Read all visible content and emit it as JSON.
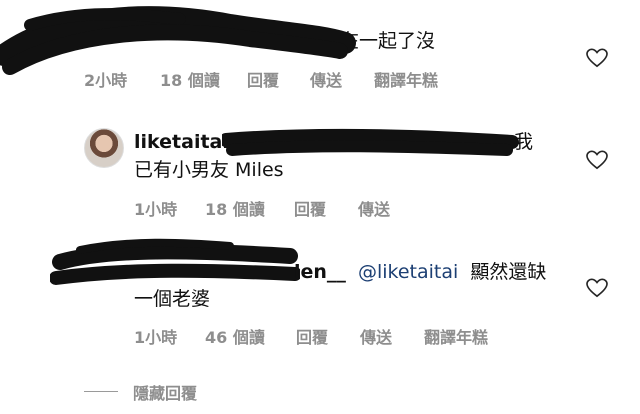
{
  "colors": {
    "meta": "#8e8e8e",
    "mention": "#1c3f73",
    "text": "#111111"
  },
  "comments": [
    {
      "text": "在一起了沒",
      "time": "2小時",
      "reads": "18 個讀",
      "reply": "回覆",
      "send": "傳送",
      "translate": "翻譯年糕"
    },
    {
      "username": "liketaitai",
      "text_line1": "我",
      "text_line2": "已有小男友 Miles",
      "time": "1小時",
      "reads": "18 個讀",
      "reply": "回覆",
      "send": "傳送"
    },
    {
      "username_fragment": "len__",
      "mention": "@liketaitai",
      "text_line1": "顯然還缺",
      "text_line2": "一個老婆",
      "time": "1小時",
      "reads": "46 個讀",
      "reply": "回覆",
      "send": "傳送",
      "translate": "翻譯年糕"
    }
  ],
  "hide_replies": "隱藏回覆",
  "icons": {
    "like": "heart-outline-icon"
  }
}
